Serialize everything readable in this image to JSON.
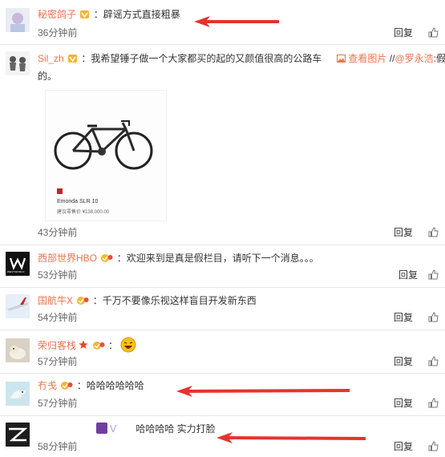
{
  "colors": {
    "name": "#eb7350",
    "arrow": "#e63330",
    "divider": "#e6e6e6"
  },
  "comments": [
    {
      "name": "秘密鸽子",
      "text": "：辟谣方式直接粗暴",
      "time": "36分钟前",
      "reply": "回复"
    },
    {
      "name": "Sil_zh",
      "text": "：我希望锤子做一个大家都买的起的又颜值很高的公路车",
      "view_image": "查看图片",
      "slash": " //",
      "mention": "@罗永浩",
      "text_end": ":假",
      "text_line2": "的。",
      "image": {
        "model": "Emonda SLR 10",
        "price": "建议零售价 ¥138,000.00"
      },
      "time": "43分钟前",
      "reply": "回复"
    },
    {
      "name": "西部世界HBO",
      "text": "：欢迎来到是真是假栏目，请听下一个消息。。。",
      "time": "53分钟前",
      "reply": "回复",
      "avatar_text": "WESTWORLD"
    },
    {
      "name": "国航牛X",
      "text": "：千万不要像乐视这样盲目开发新东西",
      "time": "54分钟前",
      "reply": "回复"
    },
    {
      "name": "荣归客栈",
      "text": "：",
      "time": "57分钟前",
      "reply": "回复"
    },
    {
      "name": "冇戋",
      "text": "：哈哈哈哈哈哈",
      "time": "57分钟前",
      "reply": "回复"
    },
    {
      "name": "",
      "text": "哈哈哈哈 实力打脸",
      "time": "58分钟前",
      "reply": "回复"
    }
  ]
}
